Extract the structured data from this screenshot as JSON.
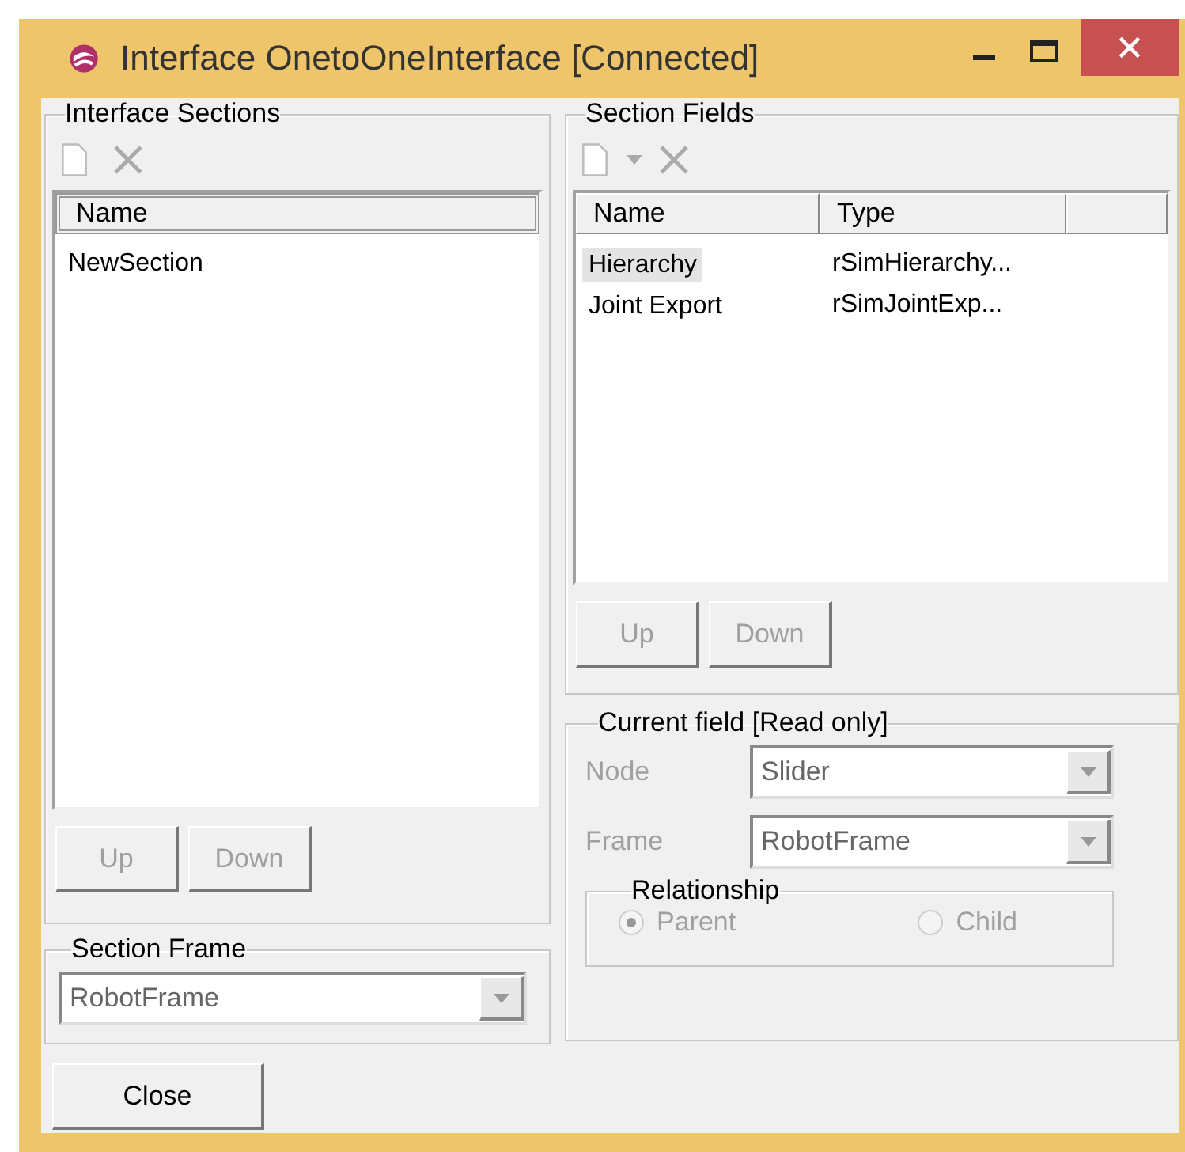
{
  "window": {
    "title": "Interface OnetoOneInterface [Connected]"
  },
  "interface_sections": {
    "title": "Interface Sections",
    "toolbar": [
      {
        "kind": "new"
      },
      {
        "kind": "delete"
      }
    ],
    "columns": [
      "Name"
    ],
    "rows": [
      {
        "name": "NewSection",
        "selected": false
      }
    ],
    "buttons": [
      {
        "label": "Up",
        "disabled": true
      },
      {
        "label": "Down",
        "disabled": true
      }
    ]
  },
  "section_frame": {
    "title": "Section Frame",
    "value": "RobotFrame",
    "disabled": true
  },
  "section_fields": {
    "title": "Section Fields",
    "toolbar": [
      {
        "kind": "new"
      },
      {
        "kind": "dropdown"
      },
      {
        "kind": "delete"
      }
    ],
    "columns": [
      "Name",
      "Type"
    ],
    "rows": [
      {
        "name": "Hierarchy",
        "type": "rSimHierarchy...",
        "selected": true
      },
      {
        "name": "Joint Export",
        "type": "rSimJointExp...",
        "selected": false
      }
    ],
    "buttons": [
      {
        "label": "Up",
        "disabled": true
      },
      {
        "label": "Down",
        "disabled": true
      }
    ]
  },
  "current_field": {
    "title": "Current field [Read only]",
    "fields": [
      {
        "label": "Node",
        "value": "Slider",
        "disabled": true
      },
      {
        "label": "Frame",
        "value": "RobotFrame",
        "disabled": true
      }
    ],
    "relationship": {
      "title": "Relationship",
      "options": [
        {
          "label": "Parent",
          "selected": true,
          "disabled": true
        },
        {
          "label": "Child",
          "selected": false,
          "disabled": true
        }
      ]
    }
  },
  "buttons": [
    {
      "label": "Close",
      "disabled": false
    }
  ]
}
